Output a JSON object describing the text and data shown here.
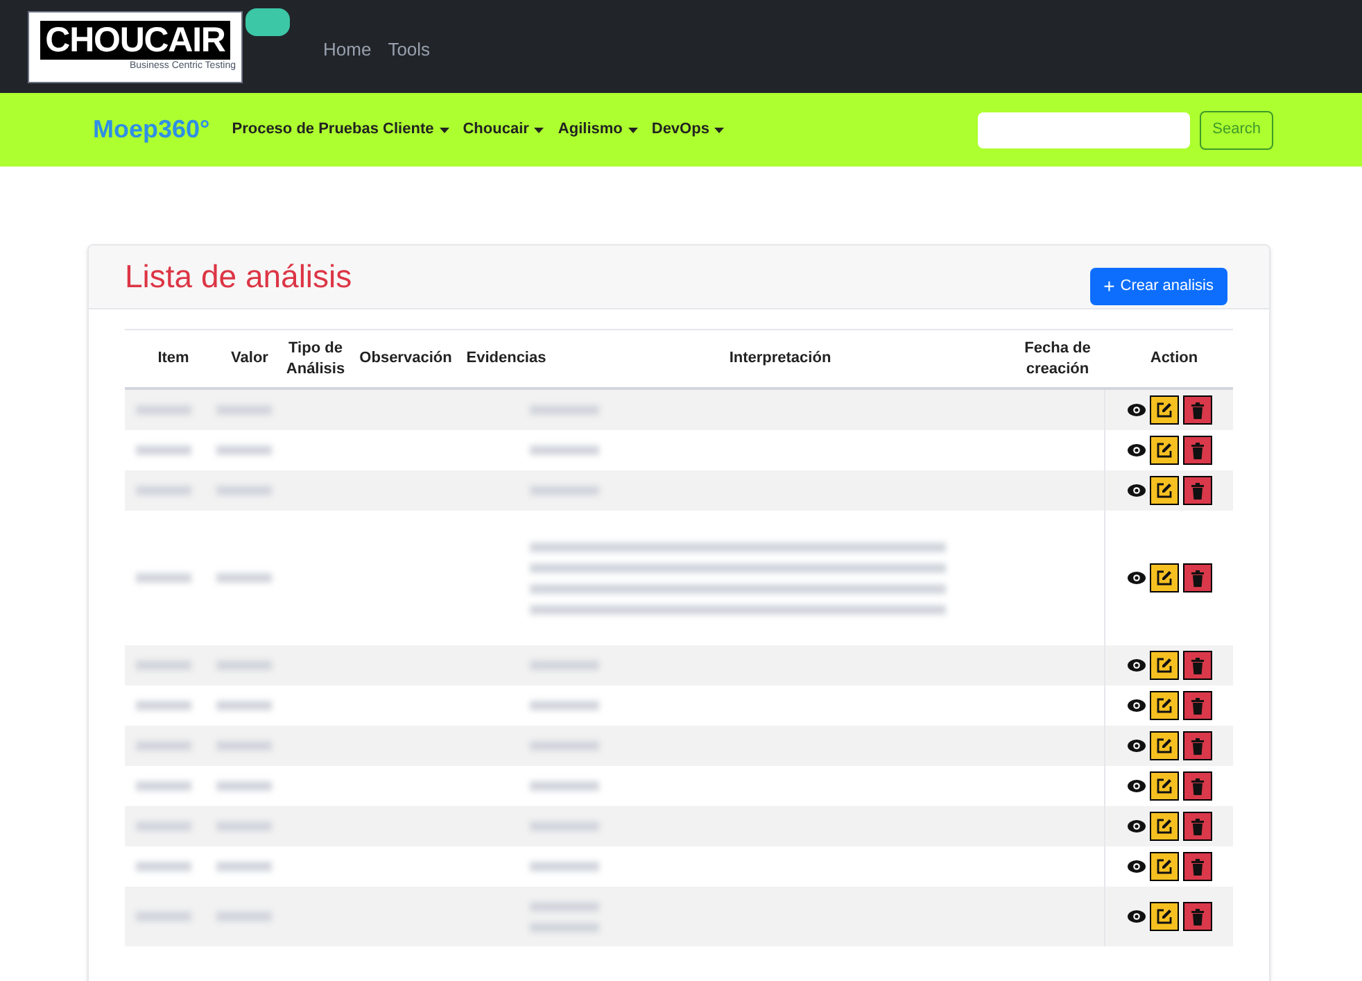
{
  "topbar": {
    "logo": {
      "name": "CHOUCAIR",
      "tagline": "Business Centric Testing"
    },
    "links": [
      "Home",
      "Tools"
    ]
  },
  "navbar": {
    "brand": "Moep360°",
    "menus": [
      "Proceso de Pruebas Cliente",
      "Choucair",
      "Agilismo",
      "DevOps"
    ],
    "search": {
      "button": "Search"
    }
  },
  "card": {
    "title": "Lista de análisis",
    "create_button": {
      "icon": "+",
      "label": "Crear analisis"
    },
    "table": {
      "columns": [
        "Item",
        "Valor",
        "Tipo de Análisis",
        "Observación",
        "Evidencias",
        "Interpretación",
        "Fecha de creación",
        "Action"
      ],
      "rows": [
        {
          "kind": "single"
        },
        {
          "kind": "single"
        },
        {
          "kind": "single"
        },
        {
          "kind": "tall"
        },
        {
          "kind": "single"
        },
        {
          "kind": "single"
        },
        {
          "kind": "single"
        },
        {
          "kind": "single"
        },
        {
          "kind": "single"
        },
        {
          "kind": "single"
        },
        {
          "kind": "double"
        }
      ]
    }
  }
}
